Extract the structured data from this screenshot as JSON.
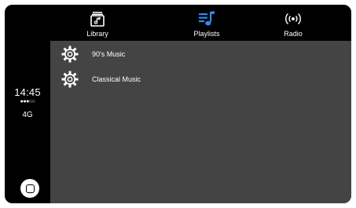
{
  "status": {
    "time": "14:45",
    "signal": "●●●○○",
    "network": "4G"
  },
  "tabs": [
    {
      "label": "Library",
      "icon": "library-icon",
      "active": false
    },
    {
      "label": "Playlists",
      "icon": "playlists-icon",
      "active": true
    },
    {
      "label": "Radio",
      "icon": "radio-icon",
      "active": false
    }
  ],
  "playlists": [
    {
      "label": "90's Music",
      "icon": "gear-icon"
    },
    {
      "label": "Classical Music",
      "icon": "gear-icon"
    }
  ],
  "colors": {
    "background": "#000000",
    "content": "#444444",
    "accent": "#2f8bf0",
    "text": "#ffffff"
  },
  "home": {
    "icon": "home-button-icon"
  }
}
